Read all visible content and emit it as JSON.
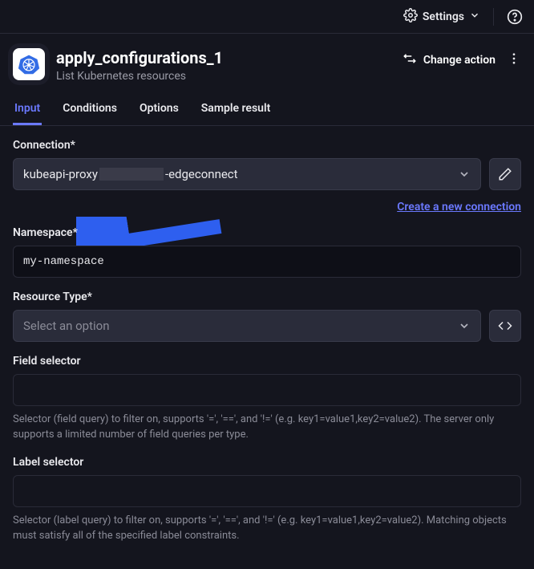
{
  "topbar": {
    "settings_label": "Settings"
  },
  "header": {
    "title": "apply_configurations_1",
    "subtitle": "List Kubernetes resources",
    "change_action_label": "Change action"
  },
  "tabs": [
    {
      "label": "Input",
      "active": true
    },
    {
      "label": "Conditions",
      "active": false
    },
    {
      "label": "Options",
      "active": false
    },
    {
      "label": "Sample result",
      "active": false
    }
  ],
  "form": {
    "connection": {
      "label": "Connection*",
      "value_prefix": "kubeapi-proxy",
      "value_suffix": "-edgeconnect",
      "create_link": "Create a new connection"
    },
    "namespace": {
      "label": "Namespace*",
      "value": "my-namespace"
    },
    "resource_type": {
      "label": "Resource Type*",
      "placeholder": "Select an option"
    },
    "field_selector": {
      "label": "Field selector",
      "value": "",
      "helper": "Selector (field query) to filter on, supports '=', '==', and '!=' (e.g. key1=value1,key2=value2). The server only supports a limited number of field queries per type."
    },
    "label_selector": {
      "label": "Label selector",
      "value": "",
      "helper": "Selector (label query) to filter on, supports '=', '==', and '!=' (e.g. key1=value1,key2=value2). Matching objects must satisfy all of the specified label constraints."
    }
  }
}
